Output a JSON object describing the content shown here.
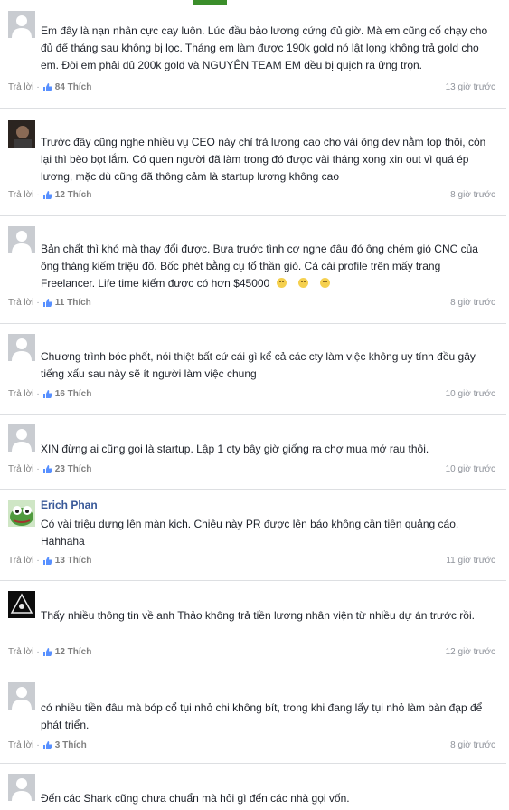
{
  "comments": [
    {
      "avatar": "default-avatar",
      "author": "",
      "text": "Em đây là nạn nhân cực cay luôn. Lúc đầu bảo lương cứng đủ giờ. Mà em cũng cố chạy cho đủ để tháng sau không bị lọc. Tháng em làm được 190k gold nó lật lọng không trả gold cho em. Đòi em phải đủ 200k gold và NGUYÊN TEAM EM đều bị quịch ra ửng trọn.",
      "reply_label": "Trả lời",
      "likes": "84 Thích",
      "time": "13 giờ trước"
    },
    {
      "avatar": "photo-avatar",
      "author": "",
      "text": "Trước đây cũng nghe nhiều vụ CEO này chỉ trả lương cao cho vài ông dev nằm top thôi, còn lại thì bèo bọt lắm. Có quen người đã làm trong đó được vài tháng xong xin out vì quá ép lương, mặc dù cũng đã thông cảm là startup lương không cao",
      "reply_label": "Trả lời",
      "likes": "12 Thích",
      "time": "8 giờ trước"
    },
    {
      "avatar": "default-avatar",
      "author": "",
      "text": "Bản chất thì khó mà thay đổi được. Bưa trước tình cơ nghe đâu đó ông chém gió CNC của ông tháng kiếm triệu đô. Bốc phét bằng cụ tổ thần gió. Cả cái profile trên mấy trang Freelancer. Life time kiếm được có hơn $45000",
      "reply_label": "Trả lời",
      "likes": "11 Thích",
      "time": "8 giờ trước"
    },
    {
      "avatar": "default-avatar",
      "author": "",
      "text": "Chương trình bóc phốt, nói thiệt bất cứ cái gì kể cả các cty làm việc không uy tính đều gây tiếng xấu sau này sẽ ít người làm việc chung",
      "reply_label": "Trả lời",
      "likes": "16 Thích",
      "time": "10 giờ trước"
    },
    {
      "avatar": "default-avatar",
      "author": "",
      "text": "XIN đừng ai cũng gọi là startup. Lập 1 cty bây giờ giống ra chợ mua mớ rau thôi.",
      "reply_label": "Trả lời",
      "likes": "23 Thích",
      "time": "10 giờ trước"
    },
    {
      "avatar": "frog-avatar",
      "author": "Erich Phan",
      "text": "Có vài triệu dựng lên màn kịch. Chiêu này PR được lên báo không cần tiền quảng cáo. Hahhaha",
      "reply_label": "Trả lời",
      "likes": "13 Thích",
      "time": "11 giờ trước"
    },
    {
      "avatar": "triangle-avatar",
      "author": "",
      "text": "Thấy nhiều thông tin về anh Thảo không trả tiền lương nhân viện từ nhiều dự án trước rồi.",
      "reply_label": "Trả lời",
      "likes": "12 Thích",
      "time": "12 giờ trước"
    },
    {
      "avatar": "default-avatar",
      "author": "",
      "text": "có nhiều tiền đâu mà bóp cổ tụi nhỏ chi không bít, trong khi đang lấy tụi nhỏ làm bàn đạp để phát triển.",
      "reply_label": "Trả lời",
      "likes": "3 Thích",
      "time": "8 giờ trước"
    },
    {
      "avatar": "default-avatar",
      "author": "",
      "text": "Đến các Shark cũng chưa chuẩn mà hỏi gì đến các nhà gọi vốn.",
      "reply_label": "",
      "likes": "",
      "time": ""
    }
  ]
}
